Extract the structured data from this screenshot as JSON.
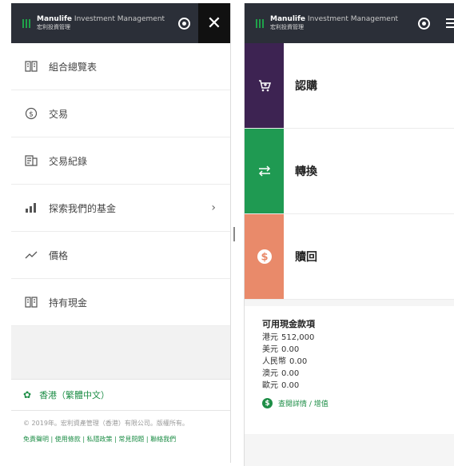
{
  "brand": {
    "name_bold": "Manulife",
    "name_rest": "Investment Management",
    "name_zh": "宏利投資管理"
  },
  "menu": {
    "close_icon": "close-icon",
    "items": [
      {
        "label": "組合總覽表",
        "icon": "book-icon"
      },
      {
        "label": "交易",
        "icon": "dollar-circle-icon"
      },
      {
        "label": "交易紀錄",
        "icon": "document-icon"
      },
      {
        "label": "探索我們的基金",
        "icon": "bar-chart-icon",
        "chevron": "›"
      },
      {
        "label": "價格",
        "icon": "trend-icon"
      },
      {
        "label": "持有現金",
        "icon": "book-icon"
      }
    ]
  },
  "language": {
    "label": "香港（繁體中文）",
    "icon": "gear-icon"
  },
  "footer": {
    "copyright": "© 2019年。宏利資產管理（香港）有限公司。版權所有。",
    "links": "免責聲明 | 使用條款 | 私隱政策 | 常見問題 | 聯絡我們"
  },
  "actions": [
    {
      "label": "認購",
      "color": "#3d2352",
      "icon": "cart-icon"
    },
    {
      "label": "轉換",
      "color": "#1f9a52",
      "icon": "switch-icon"
    },
    {
      "label": "贖回",
      "color": "#e98a6a",
      "icon": "dollar-circle-icon"
    }
  ],
  "cash": {
    "title": "可用現金款項",
    "rows": [
      {
        "currency": "港元",
        "amount": "512,000"
      },
      {
        "currency": "美元",
        "amount": "0.00"
      },
      {
        "currency": "人民幣",
        "amount": "0.00"
      },
      {
        "currency": "澳元",
        "amount": "0.00"
      },
      {
        "currency": "歐元",
        "amount": "0.00"
      }
    ],
    "transaction_label": "查閱詳情 / 增值"
  },
  "colors": {
    "header": "#2b2f38",
    "accent": "#1e8e47"
  }
}
